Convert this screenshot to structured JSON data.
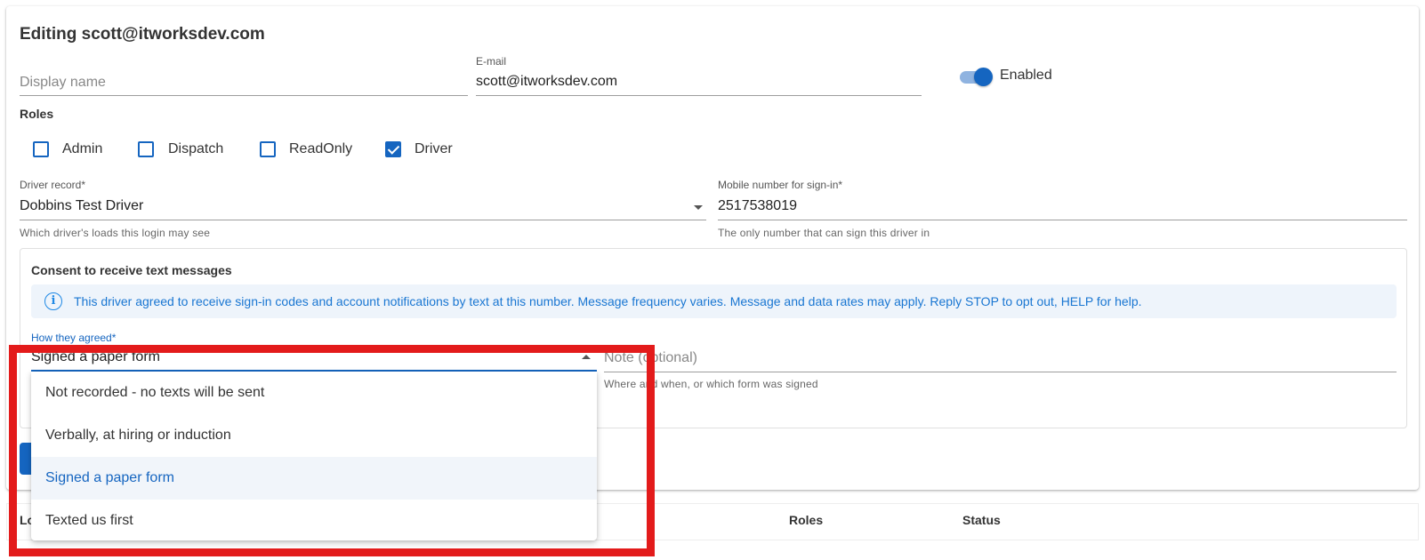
{
  "form": {
    "title": "Editing scott@itworksdev.com",
    "display_name_placeholder": "Display name",
    "email_label": "E-mail",
    "email_value": "scott@itworksdev.com",
    "enabled_label": "Enabled",
    "enabled": true
  },
  "roles": {
    "title": "Roles",
    "items": [
      {
        "label": "Admin",
        "checked": false
      },
      {
        "label": "Dispatch",
        "checked": false
      },
      {
        "label": "ReadOnly",
        "checked": false
      },
      {
        "label": "Driver",
        "checked": true
      }
    ]
  },
  "driver_record": {
    "label": "Driver record*",
    "value": "Dobbins Test Driver",
    "helper": "Which driver's loads this login may see"
  },
  "mobile": {
    "label": "Mobile number for sign-in*",
    "value": "2517538019",
    "helper": "The only number that can sign this driver in"
  },
  "consent": {
    "title": "Consent to receive text messages",
    "info": "This driver agreed to receive sign-in codes and account notifications by text at this number. Message frequency varies. Message and data rates may apply. Reply STOP to opt out, HELP for help.",
    "how_label": "How they agreed*",
    "how_value": "Signed a paper form",
    "note_placeholder": "Note (optional)",
    "note_helper": "Where and when, or which form was signed",
    "options": [
      "Not recorded - no texts will be sent",
      "Verbally, at hiring or induction",
      "Signed a paper form",
      "Texted us first"
    ],
    "selected_index": 2
  },
  "table": {
    "login_header": "Lo",
    "roles_header": "Roles",
    "status_header": "Status"
  },
  "colors": {
    "primary": "#1565c0",
    "highlight": "#e31b1b",
    "info_bg": "#eef4fb"
  }
}
